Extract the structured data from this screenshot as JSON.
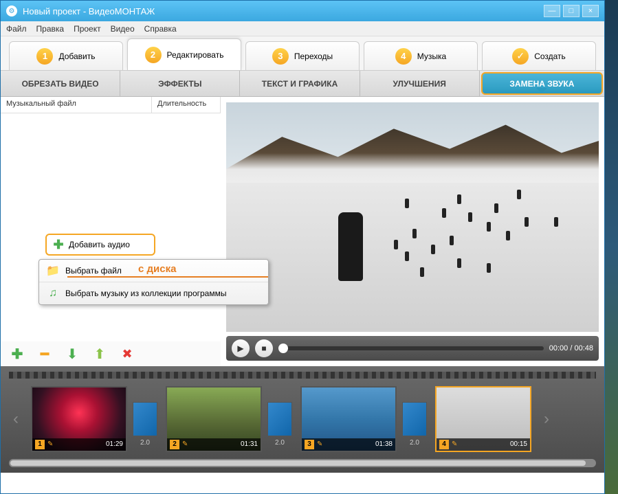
{
  "window": {
    "title": "Новый проект - ВидеоМОНТАЖ"
  },
  "menu": {
    "file": "Файл",
    "edit": "Правка",
    "project": "Проект",
    "video": "Видео",
    "help": "Справка"
  },
  "steps": {
    "add": "Добавить",
    "edit": "Редактировать",
    "transitions": "Переходы",
    "music": "Музыка",
    "create": "Создать"
  },
  "subtabs": {
    "trim": "ОБРЕЗАТЬ ВИДЕО",
    "effects": "ЭФФЕКТЫ",
    "text": "ТЕКСТ И ГРАФИКА",
    "improve": "УЛУЧШЕНИЯ",
    "audio": "ЗАМЕНА ЗВУКА"
  },
  "listHeaders": {
    "file": "Музыкальный файл",
    "duration": "Длительность"
  },
  "addAudio": "Добавить аудио",
  "contextMenu": {
    "fromDisk": "Выбрать файл",
    "fromCollection": "Выбрать музыку из коллекции программы"
  },
  "annotation": "с диска",
  "player": {
    "time": "00:00 / 00:48"
  },
  "clips": [
    {
      "num": "1",
      "time": "01:29"
    },
    {
      "num": "2",
      "time": "01:31"
    },
    {
      "num": "3",
      "time": "01:38"
    },
    {
      "num": "4",
      "time": "00:15"
    }
  ],
  "transition": "2.0"
}
